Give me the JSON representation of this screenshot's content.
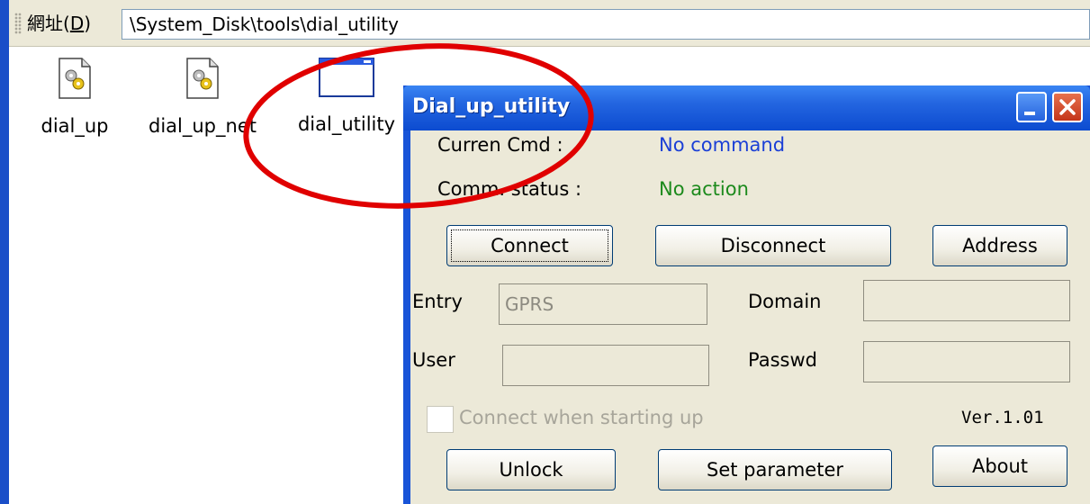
{
  "address_bar": {
    "label_prefix": "網址(",
    "label_key": "D",
    "label_suffix": ")",
    "path": "\\System_Disk\\tools\\dial_utility"
  },
  "files": [
    {
      "name": "dial_up",
      "icon": "gear-document-icon"
    },
    {
      "name": "dial_up_net",
      "icon": "gear-document-icon"
    },
    {
      "name": "dial_utility",
      "icon": "application-window-icon"
    }
  ],
  "dialog": {
    "title": "Dial_up_utility",
    "current_cmd_label": "Curren Cmd :",
    "current_cmd_value": "No command",
    "comm_status_label": "Comm. status :",
    "comm_status_value": "No action",
    "buttons": {
      "connect": "Connect",
      "disconnect": "Disconnect",
      "address": "Address",
      "unlock": "Unlock",
      "set_parameter": "Set parameter",
      "about": "About"
    },
    "fields": {
      "entry_label": "Entry",
      "entry_value": "GPRS",
      "domain_label": "Domain",
      "domain_value": "",
      "user_label": "User",
      "user_value": "",
      "passwd_label": "Passwd",
      "passwd_value": ""
    },
    "checkbox_label": "Connect when starting up",
    "checkbox_checked": false,
    "version": "Ver.1.01"
  },
  "colors": {
    "title_bar": "#2365e0",
    "annotation": "#e00000",
    "status_blue": "#1b3fd6",
    "status_green": "#1c8a1c"
  }
}
